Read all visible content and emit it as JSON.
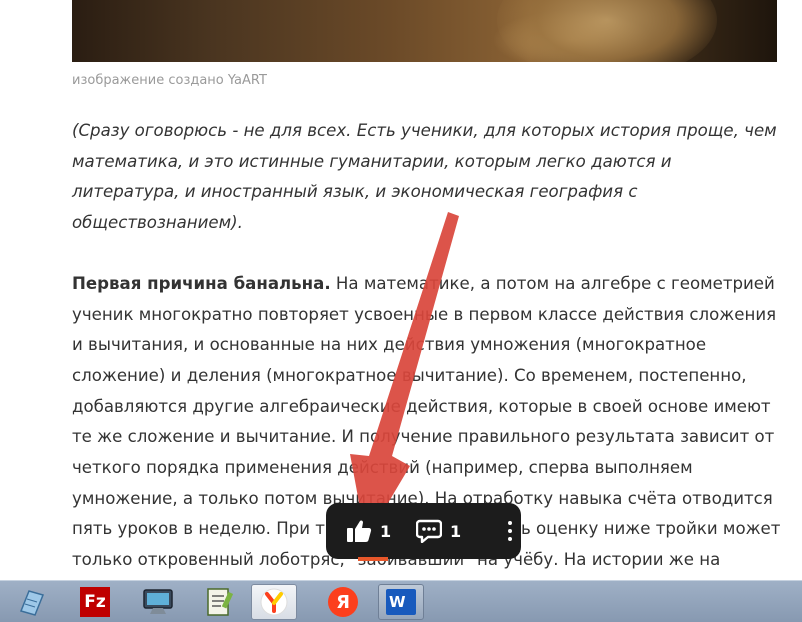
{
  "caption": "изображение создано YaART",
  "intro": "(Сразу оговорюсь - не для всех. Есть ученики, для которых история проще, чем математика, и это истинные гуманитарии, которым легко даются и литература, и иностранный язык, и экономическая география с обществознанием).",
  "paragraph": {
    "lead": "Первая причина банальна.",
    "body": " На математике, а потом на алгебре с геометрией ученик многократно повторяет усвоенные в первом классе действия сложения и вычитания, и основанные на них действия умножения (многократное сложение) и деления (многократное вычитание). Со временем, постепенно, добавляются другие алгебраические действия, которые в своей основе имеют те же сложение и вычитание. И получение правильного результата зависит от четкого порядка применения действий (например, сперва выполняем умножение, а только потом вычитание). На отработку навыка счёта отводится пять уроков в неделю. При такой подготовке иметь оценку ниже тройки может только откровенный лоботряс, \"забивавший\" на учёбу. На истории же на каждом из двух уроков в неделю"
  },
  "reactions": {
    "likes": "1",
    "comments": "1"
  },
  "colors": {
    "arrow": "#d9453b",
    "bar_background": "#1c1c1c",
    "accent": "#e8572a"
  },
  "taskbar": {
    "icons": [
      "notepad-icon",
      "filezilla-icon",
      "monitor-icon",
      "text-editor-icon",
      "yandex-browser-icon",
      "yandex-icon",
      "word-icon"
    ],
    "filezilla_label": "Fz",
    "yandex_label": "Я",
    "word_label": "W"
  }
}
